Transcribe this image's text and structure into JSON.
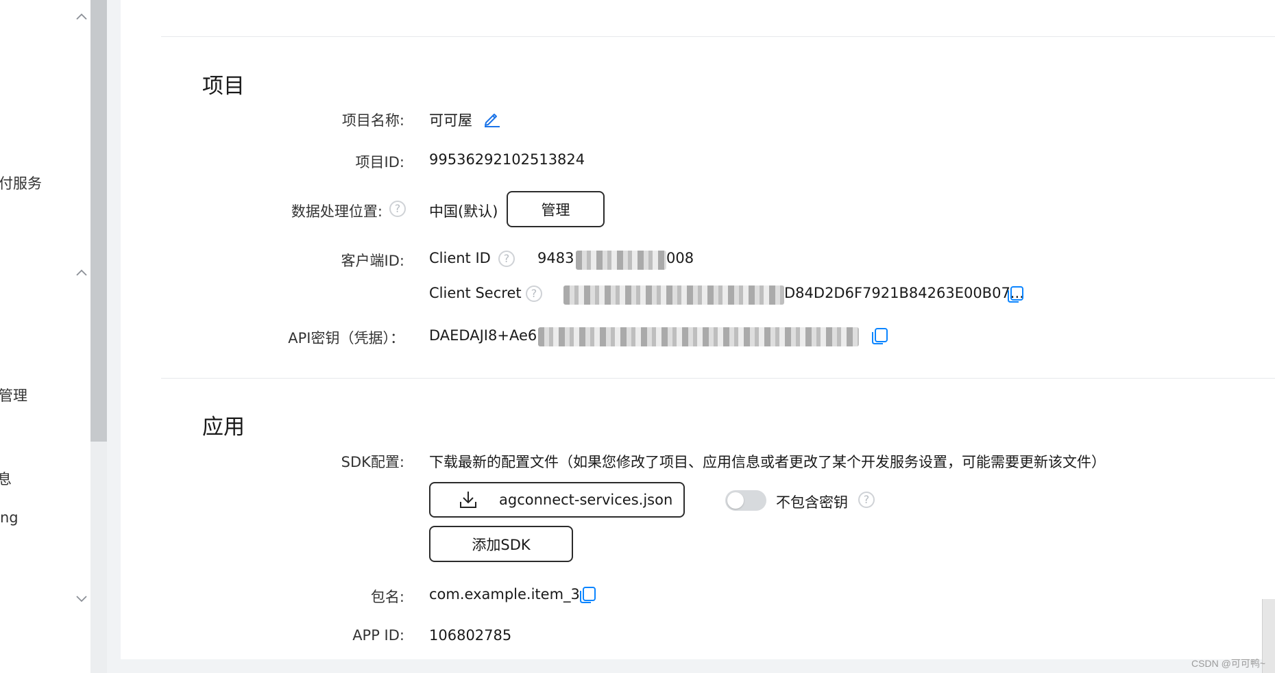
{
  "sidebar": {
    "items": [
      {
        "label": "付服务"
      },
      {
        "label": "管理"
      },
      {
        "label": "息"
      },
      {
        "label": "ng"
      }
    ]
  },
  "project": {
    "title": "项目",
    "name_label": "项目名称:",
    "name_value": "可可屋",
    "id_label": "项目ID:",
    "id_value": "99536292102513824",
    "location_label": "数据处理位置:",
    "location_value": "中国(默认)",
    "manage_button": "管理",
    "client_label": "客户端ID:",
    "client_id_label": "Client ID",
    "client_id_value_start": "9483",
    "client_id_value_end": "008",
    "client_secret_label": "Client Secret",
    "client_secret_value_end": "D84D2D6F7921B84263E00B07...",
    "api_label": "API密钥（凭据）：",
    "api_value_start": "DAEDAJI8+Ae6"
  },
  "app": {
    "title": "应用",
    "sdk_label": "SDK配置:",
    "sdk_desc": "下载最新的配置文件（如果您修改了项目、应用信息或者更改了某个开发服务设置，可能需要更新该文件）",
    "download_button": "agconnect-services.json",
    "exclude_secret_label": "不包含密钥",
    "exclude_secret_on": false,
    "add_sdk_button": "添加SDK",
    "package_label": "包名:",
    "package_value": "com.example.item_3",
    "appid_label": "APP ID:",
    "appid_value": "106802785"
  },
  "help_glyph": "?",
  "watermark": "CSDN @可可鸭~",
  "colors": {
    "accent": "#0a84ff",
    "edit_icon": "#1a73e8"
  }
}
